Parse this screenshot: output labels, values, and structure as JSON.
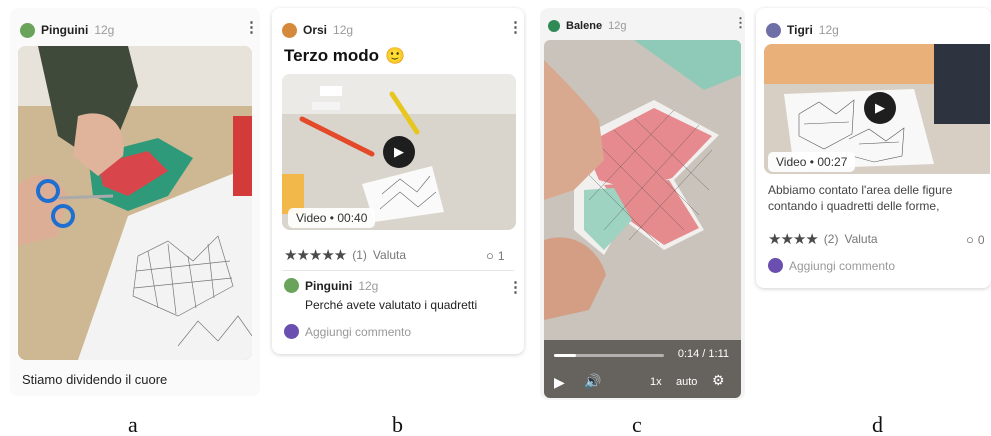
{
  "panels": {
    "a": {
      "group": "Pinguini",
      "tag": "12g",
      "text": "Stiamo dividendo il cuore"
    },
    "b": {
      "group": "Orsi",
      "tag": "12g",
      "title": "Terzo modo",
      "emoji": "🙂",
      "video_chip": "Video • 00:40",
      "rating_count": "(1)",
      "rate_label": "Valuta",
      "comments_count": "1",
      "comment": {
        "group": "Pinguini",
        "tag": "12g",
        "text": "Perché avete valutato i quadretti"
      },
      "add_comment": "Aggiungi commento"
    },
    "c": {
      "group": "Balene",
      "tag": "12g",
      "time": "0:14 / 1:11",
      "progress": 0.2,
      "speed": "1x",
      "quality": "auto"
    },
    "d": {
      "group": "Tigri",
      "tag": "12g",
      "video_chip": "Video • 00:27",
      "text": "Abbiamo contato l'area delle figure contando i quadretti delle forme,",
      "rating_count": "(2)",
      "rate_label": "Valuta",
      "comments_count": "0",
      "add_comment": "Aggiungi commento"
    }
  },
  "captions": [
    "a",
    "b",
    "c",
    "d"
  ],
  "colors": {
    "pinguini": "#6aa35a",
    "orsi": "#d48a3a",
    "balene": "#2f8a55",
    "tigri": "#6f6fa8",
    "viewer": "#6a4fb0"
  }
}
